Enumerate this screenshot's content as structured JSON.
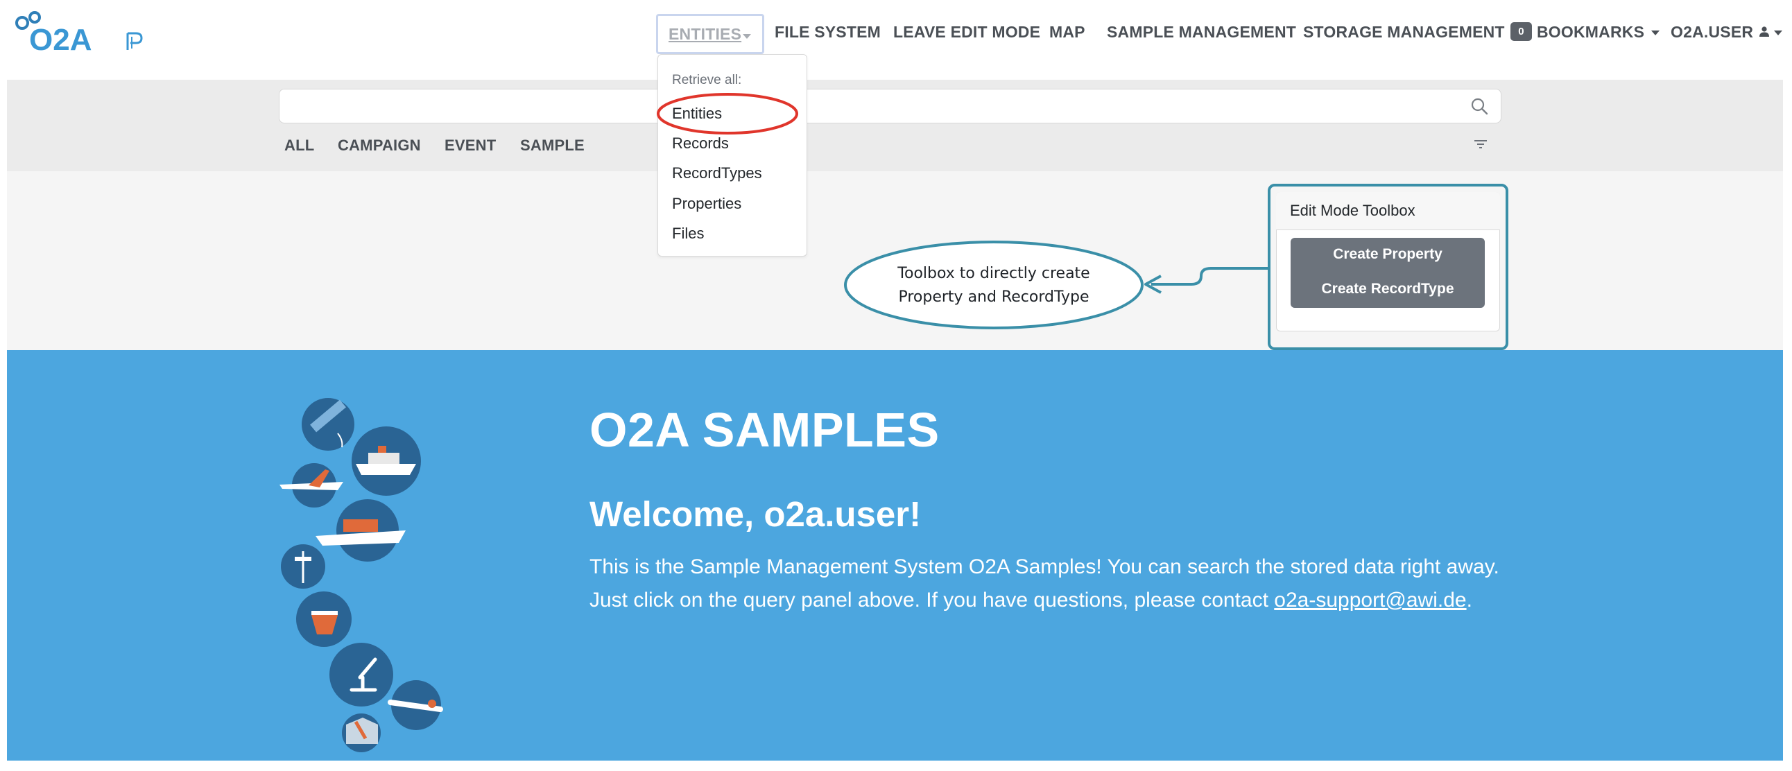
{
  "nav": {
    "logo_text": "O2A",
    "entities": "ENTITIES",
    "file_system": "FILE SYSTEM",
    "leave_edit_mode": "LEAVE EDIT MODE",
    "map": "MAP",
    "sample_management": "SAMPLE MANAGEMENT",
    "storage_management": "STORAGE MANAGEMENT",
    "bookmarks_count": "0",
    "bookmarks": "BOOKMARKS",
    "user": "O2A.USER"
  },
  "dropdown": {
    "header": "Retrieve all:",
    "items": [
      "Entities",
      "Records",
      "RecordTypes",
      "Properties",
      "Files"
    ]
  },
  "search": {
    "placeholder": "",
    "categories": [
      "ALL",
      "CAMPAIGN",
      "EVENT",
      "SAMPLE"
    ]
  },
  "toolbox": {
    "title": "Edit Mode Toolbox",
    "create_property": "Create Property",
    "create_recordtype": "Create RecordType"
  },
  "callout": {
    "line1": "Toolbox to directly create",
    "line2": "Property and RecordType"
  },
  "hero": {
    "title": "O2A SAMPLES",
    "welcome": "Welcome, o2a.user!",
    "text": "This is the Sample Management System O2A Samples! You can search the stored data right away. Just click on the query panel above. If you have questions, please contact ",
    "email": "o2a-support@awi.de",
    "period": "."
  },
  "colors": {
    "hero_bg": "#4ca6df",
    "annotation": "#3a8fa8",
    "highlight_red": "#e0352b",
    "button_gray": "#6c737c",
    "brand_blue": "#3a97d4"
  },
  "icons": [
    "search-icon",
    "filter-icon",
    "user-icon",
    "caret-down-icon"
  ]
}
